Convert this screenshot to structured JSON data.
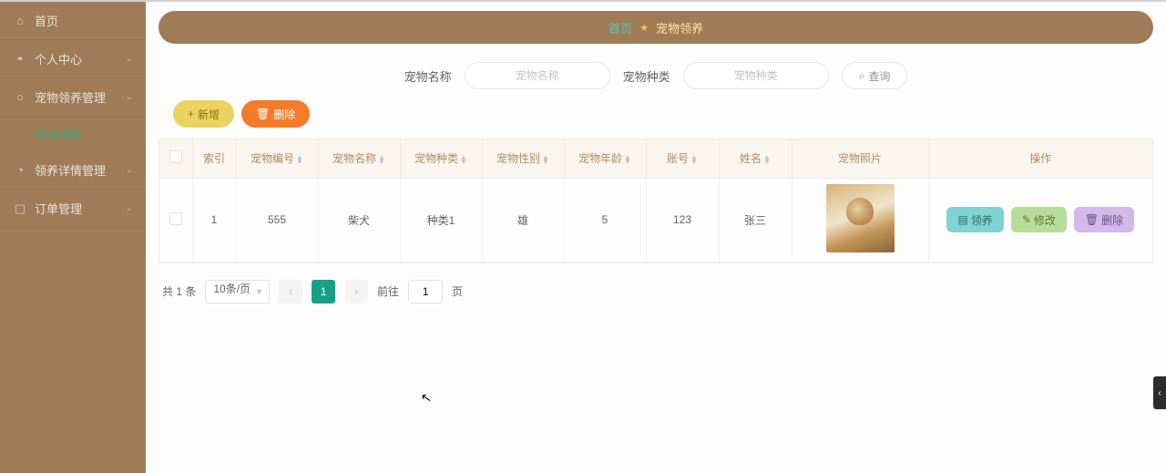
{
  "sidebar": {
    "items": [
      {
        "icon": "home-icon",
        "label": "首页",
        "expandable": false
      },
      {
        "icon": "user-icon",
        "label": "个人中心",
        "expandable": true
      },
      {
        "icon": "paw-icon",
        "label": "宠物领养管理",
        "expandable": true,
        "children": [
          {
            "label": "宠物领养"
          }
        ]
      },
      {
        "icon": "thumb-icon",
        "label": "领养详情管理",
        "expandable": true
      },
      {
        "icon": "flag-icon",
        "label": "订单管理",
        "expandable": true
      }
    ]
  },
  "breadcrumb": {
    "home": "首页",
    "current": "宠物领养"
  },
  "filters": {
    "name_label": "宠物名称",
    "name_placeholder": "宠物名称",
    "type_label": "宠物种类",
    "type_placeholder": "宠物种类",
    "query_label": "查询"
  },
  "toolbar": {
    "add_label": "新增",
    "delete_label": "删除"
  },
  "table": {
    "columns": [
      "索引",
      "宠物编号",
      "宠物名称",
      "宠物种类",
      "宠物性别",
      "宠物年龄",
      "账号",
      "姓名",
      "宠物照片",
      "操作"
    ],
    "rows": [
      {
        "index": "1",
        "code": "555",
        "name": "柴犬",
        "type": "种类1",
        "sex": "雄",
        "age": "5",
        "account": "123",
        "user": "张三"
      }
    ],
    "row_actions": {
      "adopt": "领养",
      "edit": "修改",
      "delete": "删除"
    }
  },
  "pagination": {
    "total_text": "共 1 条",
    "page_size_label": "10条/页",
    "current_page": "1",
    "jump_prefix": "前往",
    "jump_suffix": "页",
    "jump_value": "1"
  }
}
